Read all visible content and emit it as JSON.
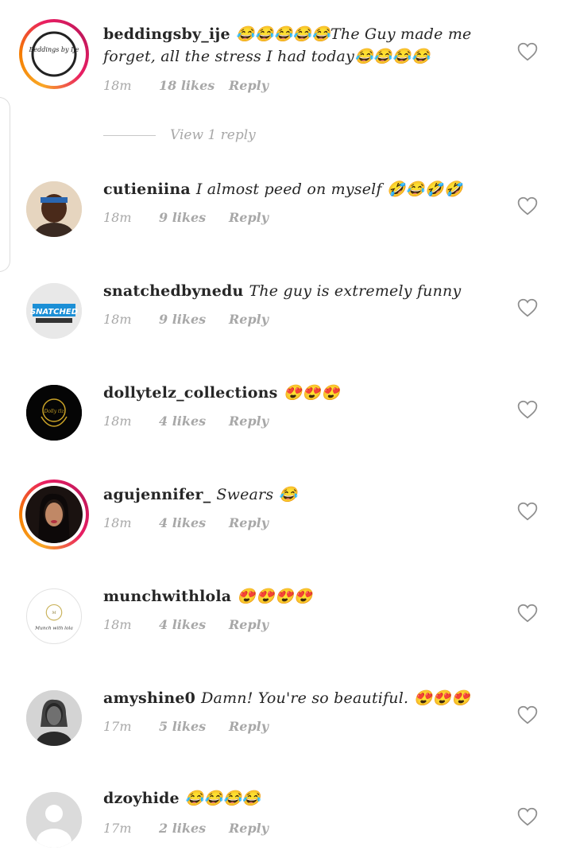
{
  "comments": [
    {
      "username": "beddingsby_ije",
      "text": "😂😂😂😂😂The Guy made me forget, all the stress I had today😂😂😂😂",
      "time": "18m",
      "likes": "18 likes",
      "reply": "Reply",
      "avatar_label": "Beddings by Ije",
      "view_replies": "View 1 reply"
    },
    {
      "username": "cutieniina",
      "text": "I almost peed on myself 🤣😂🤣🤣",
      "time": "18m",
      "likes": "9 likes",
      "reply": "Reply"
    },
    {
      "username": "snatchedbynedu",
      "text": "The guy is extremely funny",
      "time": "18m",
      "likes": "9 likes",
      "reply": "Reply",
      "avatar_label": "SNATCHED"
    },
    {
      "username": "dollytelz_collections",
      "text": "😍😍😍",
      "time": "18m",
      "likes": "4 likes",
      "reply": "Reply",
      "avatar_label": "Dolly tlz"
    },
    {
      "username": "agujennifer_",
      "text": "Swears 😂",
      "time": "18m",
      "likes": "4 likes",
      "reply": "Reply"
    },
    {
      "username": "munchwithlola",
      "text": "😍😍😍😍",
      "time": "18m",
      "likes": "4 likes",
      "reply": "Reply",
      "avatar_label": "Munch with lola"
    },
    {
      "username": "amyshine0",
      "text": "Damn! You're so beautiful. 😍😍😍",
      "time": "17m",
      "likes": "5 likes",
      "reply": "Reply"
    },
    {
      "username": "dzoyhide",
      "text": "😂😂😂😂",
      "time": "17m",
      "likes": "2 likes",
      "reply": "Reply"
    }
  ],
  "icons": {
    "like": "heart-outline-icon"
  },
  "colors": {
    "meta": "#a8a8a8",
    "text": "#262626",
    "story_ring": "#e91e63"
  }
}
